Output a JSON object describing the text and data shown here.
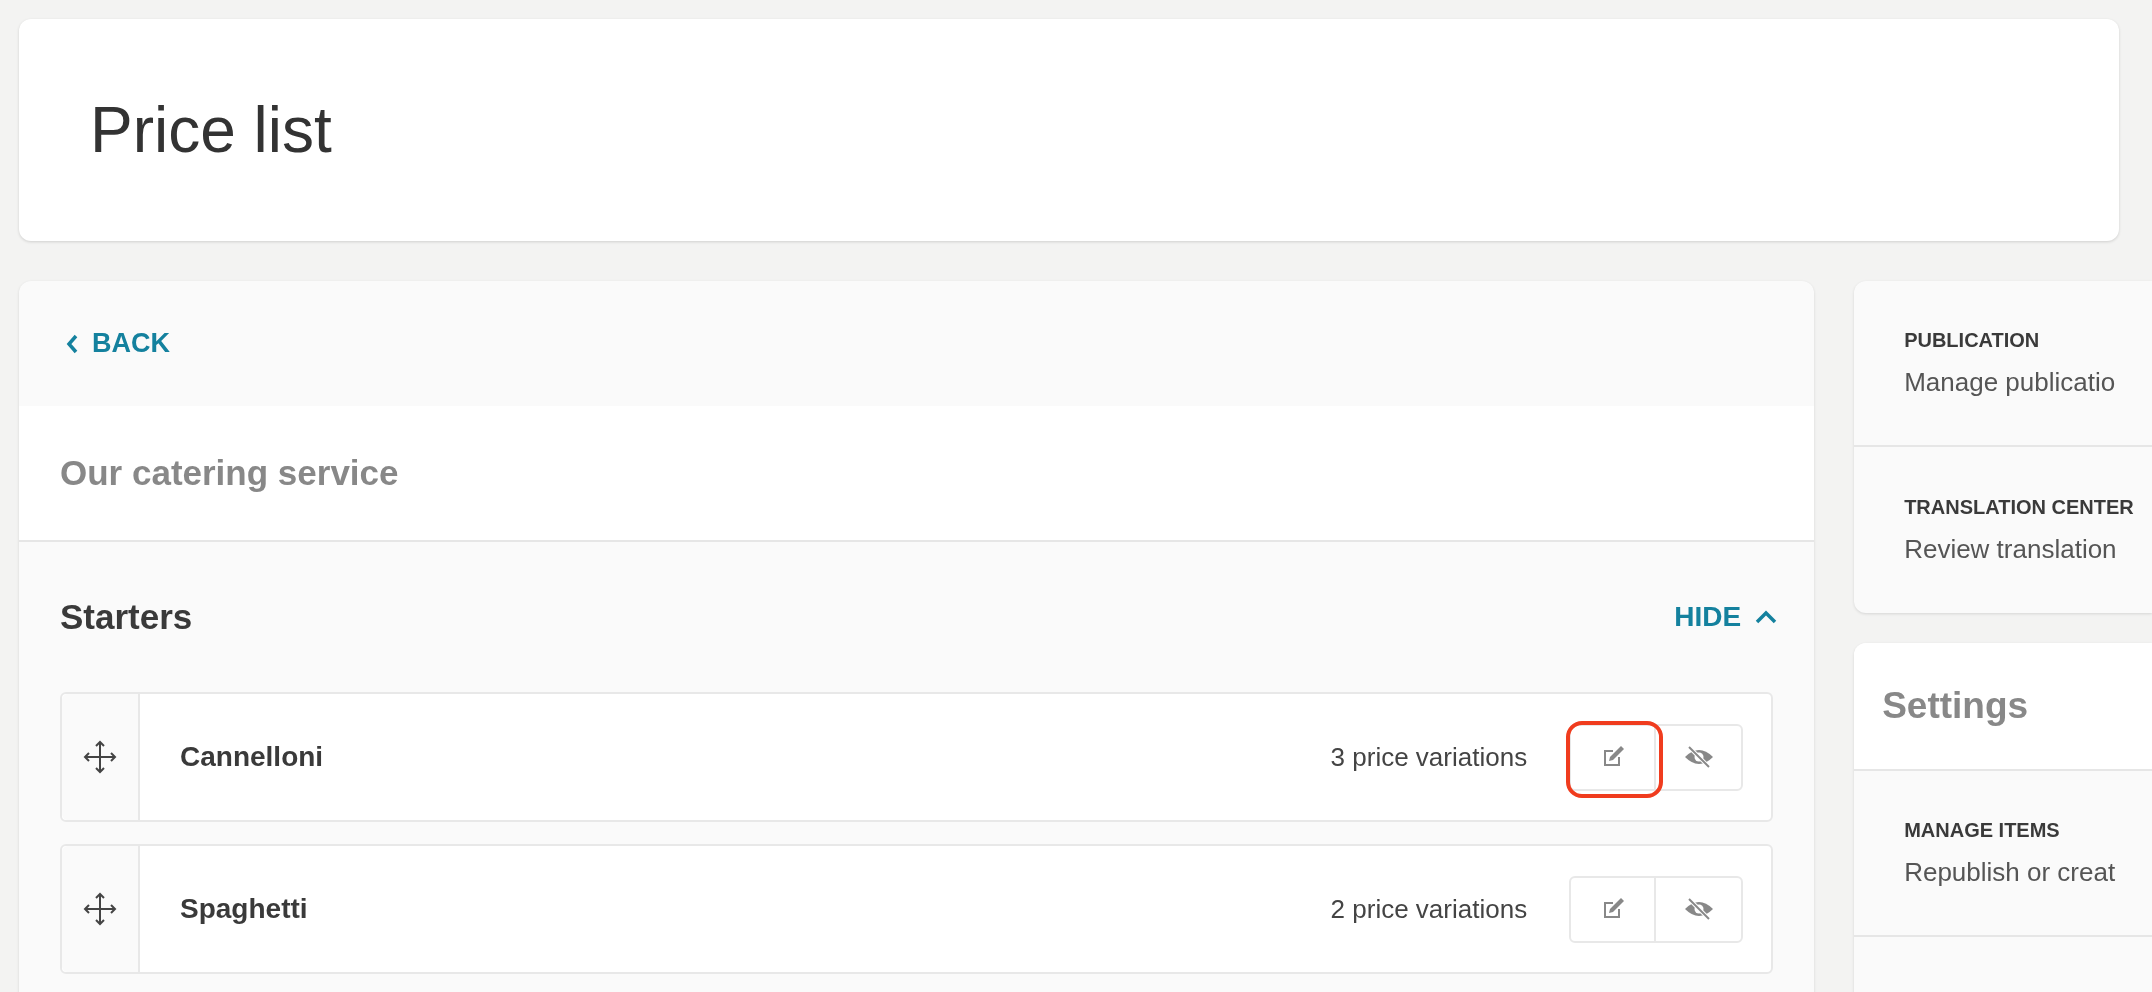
{
  "header": {
    "title": "Price list"
  },
  "back": {
    "label": "BACK"
  },
  "catalog": {
    "title": "Our catering service"
  },
  "section": {
    "title": "Starters",
    "toggle_label": "HIDE",
    "expanded": true,
    "items": [
      {
        "name": "Cannelloni",
        "variations": "3 price variations",
        "edit_highlighted": true
      },
      {
        "name": "Spaghetti",
        "variations": "2 price variations",
        "edit_highlighted": false
      }
    ]
  },
  "sidebar": {
    "links": [
      {
        "label": "PUBLICATION",
        "description": "Manage publicatio"
      },
      {
        "label": "TRANSLATION CENTER",
        "description": "Review translation"
      }
    ],
    "settings": {
      "title": "Settings",
      "items": [
        {
          "label": "MANAGE ITEMS",
          "description": "Republish or creat"
        }
      ]
    }
  }
}
